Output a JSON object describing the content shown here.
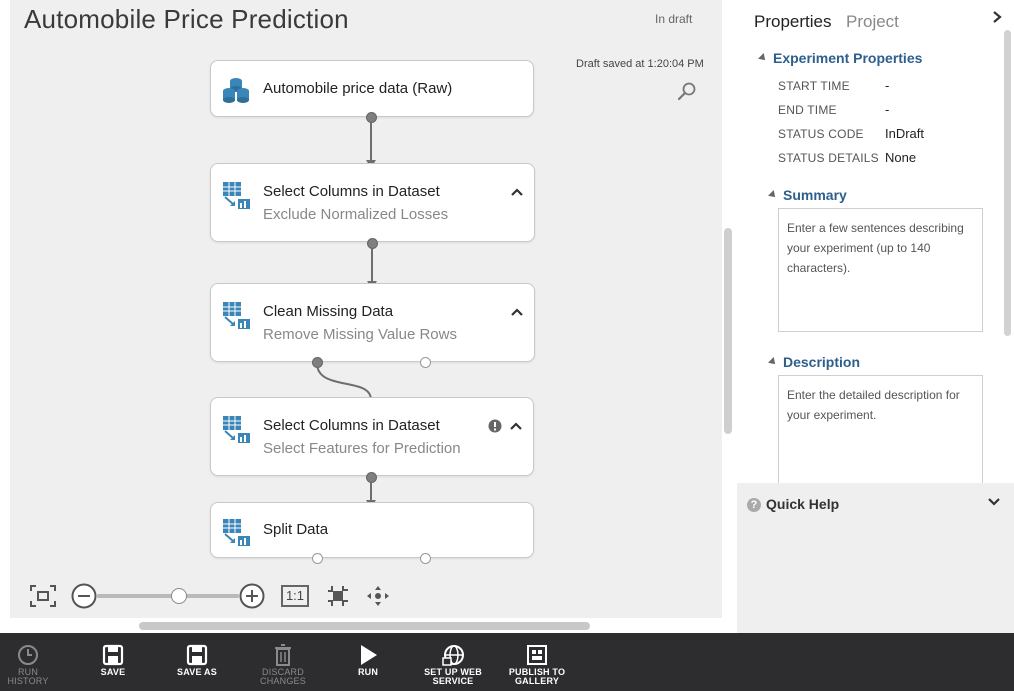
{
  "experiment": {
    "title": "Automobile Price Prediction",
    "status": "In draft",
    "saved_text": "Draft saved at 1:20:04 PM"
  },
  "modules": [
    {
      "title": "Automobile price data (Raw)",
      "subtitle": ""
    },
    {
      "title": "Select Columns in Dataset",
      "subtitle": "Exclude Normalized Losses"
    },
    {
      "title": "Clean Missing Data",
      "subtitle": "Remove Missing Value Rows"
    },
    {
      "title": "Select Columns in Dataset",
      "subtitle": "Select Features for Prediction"
    },
    {
      "title": "Split Data",
      "subtitle": ""
    }
  ],
  "zoom": {
    "one_to_one_label": "1:1",
    "level": 0.6
  },
  "panel": {
    "tabs": [
      "Properties",
      "Project"
    ],
    "experiment_properties": {
      "heading": "Experiment Properties",
      "rows": [
        {
          "label": "START TIME",
          "value": "-"
        },
        {
          "label": "END TIME",
          "value": "-"
        },
        {
          "label": "STATUS CODE",
          "value": "InDraft"
        },
        {
          "label": "STATUS DETAILS",
          "value": "None"
        }
      ]
    },
    "summary": {
      "heading": "Summary",
      "placeholder": "Enter a few sentences describing your experiment (up to 140 characters)."
    },
    "description": {
      "heading": "Description",
      "placeholder": "Enter the detailed description for your experiment."
    },
    "quick_help": {
      "label": "Quick Help",
      "icon_glyph": "?"
    }
  },
  "toolbar": {
    "run_history": "RUN HISTORY",
    "save": "SAVE",
    "save_as": "SAVE AS",
    "discard": "DISCARD CHANGES",
    "run": "RUN",
    "web_service_line1": "SET UP WEB",
    "web_service_line2": "SERVICE",
    "publish_line1": "PUBLISH TO",
    "publish_line2": "GALLERY"
  },
  "colors": {
    "toolbar_bg": "#2d2d30",
    "accent": "#2d5f8c",
    "module_icon": "#3a86b8"
  },
  "icons": {
    "dataset": "database-icon",
    "module": "module-icon",
    "search": "magnifier-icon",
    "warning": "warning-icon"
  }
}
